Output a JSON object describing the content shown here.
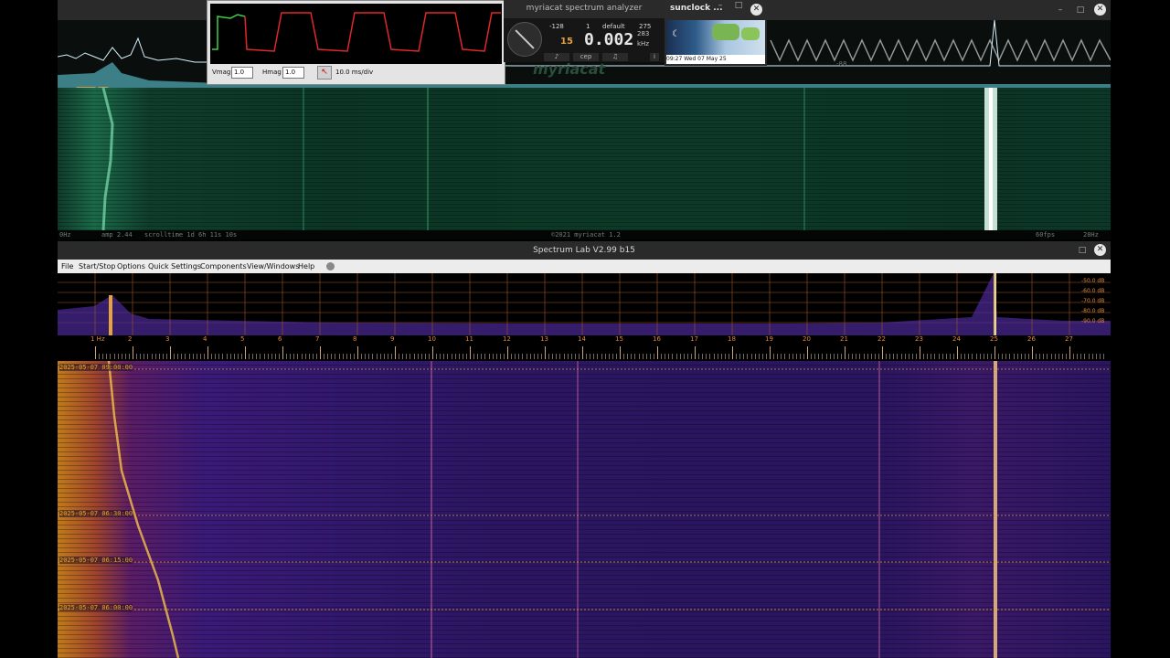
{
  "myriacat": {
    "title": "myriacat spectrum analyzer",
    "status_left": "0Hz",
    "status_amp": "amp 2.44",
    "status_scroll": "scrolltime 1d 6h 11s 10s",
    "status_copyright": "©2021 myriacat 1.2",
    "status_fps": "60fps",
    "status_right": "28Hz",
    "logo": "myriacat",
    "center_value": "-88"
  },
  "scope": {
    "vmag_label": "Vmag",
    "vmag_value": "1.0",
    "hmag_label": "Hmag",
    "hmag_value": "1.0",
    "timebase": "10.0 ms/div"
  },
  "panel": {
    "top_left": "-128",
    "top_mid": "1",
    "top_preset": "default",
    "top_right": "275",
    "big_value": "0.002",
    "small_value": "15",
    "right_num": "283",
    "unit": "kHz",
    "btn1": "♪",
    "btn2": "cep",
    "btn3": "♫",
    "info": "i"
  },
  "sunclock": {
    "title": "sunclock ...",
    "date": "09:27  Wed  07  May  25"
  },
  "spectrumlab": {
    "title": "Spectrum Lab V2.99 b15",
    "menu": [
      "File",
      "Start/Stop",
      "Options",
      "Quick Settings",
      "Components",
      "View/Windows",
      "Help"
    ],
    "db_labels": [
      "-50.0 dB",
      "-60.0 dB",
      "-70.0 dB",
      "-80.0 dB",
      "-90.0 dB"
    ],
    "freq_ticks": [
      "1 Hz",
      "2",
      "3",
      "4",
      "5",
      "6",
      "7",
      "8",
      "9",
      "10",
      "11",
      "12",
      "13",
      "14",
      "15",
      "16",
      "17",
      "18",
      "19",
      "20",
      "21",
      "22",
      "23",
      "24",
      "25",
      "26",
      "27"
    ],
    "timestamps": [
      "2025-05-07 09:00:00",
      "2025-05-07 06:30:00",
      "2025-05-07 06:15:00",
      "2025-05-07 06:00:00"
    ]
  }
}
